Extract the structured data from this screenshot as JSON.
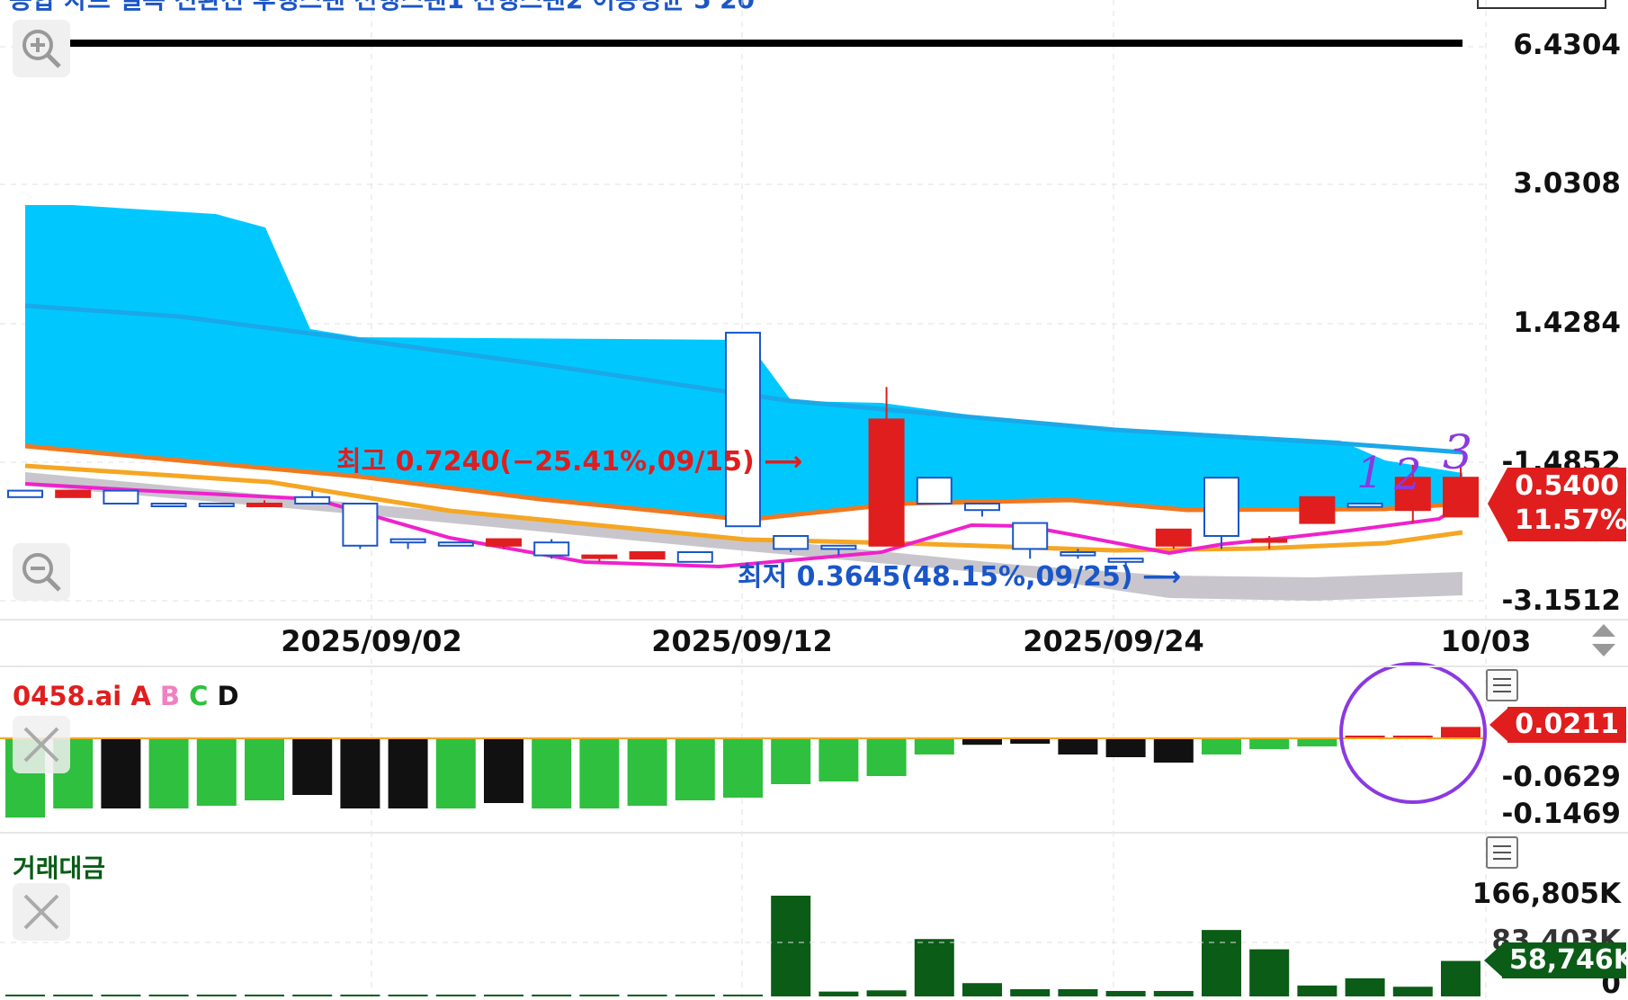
{
  "header": {
    "top_cut_text": "종합 차트 일목 전환선 후행스팬 선행스팬1 선행스팬2 이동평균 5 20"
  },
  "price_axis": {
    "labels": [
      "6.4304",
      "3.0308",
      "1.4284",
      "-1.4852",
      "-3.1512"
    ]
  },
  "current_price": {
    "value": "0.5400",
    "change": "11.57%",
    "color": "#e01e1e"
  },
  "annotations": {
    "high": "최고 0.7240(−25.41%,09/15)",
    "low": "최저 0.3645(48.15%,09/25)",
    "numbers": [
      "1",
      "2",
      "3"
    ]
  },
  "date_axis": {
    "labels": [
      "2025/09/02",
      "2025/09/12",
      "2025/09/24",
      "10/03"
    ]
  },
  "indicator": {
    "name": "0458.ai",
    "series_letters": [
      "A",
      "B",
      "C",
      "D"
    ],
    "current_value": "0.0211",
    "axis_labels": [
      "-0.0629",
      "-0.1469"
    ],
    "values": [
      -0.1469,
      -0.13,
      -0.13,
      -0.13,
      -0.125,
      -0.115,
      -0.105,
      -0.13,
      -0.13,
      -0.13,
      -0.12,
      -0.13,
      -0.13,
      -0.125,
      -0.115,
      -0.11,
      -0.085,
      -0.08,
      -0.07,
      -0.03,
      -0.012,
      -0.01,
      -0.03,
      -0.035,
      -0.045,
      -0.03,
      -0.02,
      -0.015,
      0.002,
      0.004,
      0.0211
    ],
    "bar_colors": [
      "green",
      "green",
      "black",
      "green",
      "green",
      "green",
      "black",
      "black",
      "black",
      "green",
      "black",
      "green",
      "green",
      "green",
      "green",
      "green",
      "green",
      "green",
      "green",
      "green",
      "black",
      "black",
      "black",
      "black",
      "black",
      "green",
      "green",
      "green",
      "red",
      "red",
      "red"
    ]
  },
  "volume": {
    "title": "거래대금",
    "axis_labels": [
      "166,805K",
      "83,403K",
      "0"
    ],
    "current_value": "58,746K",
    "values": [
      300,
      300,
      300,
      300,
      300,
      300,
      300,
      300,
      300,
      300,
      300,
      300,
      300,
      300,
      300,
      300,
      166805,
      8000,
      10000,
      95000,
      22000,
      12000,
      12000,
      9000,
      9000,
      110000,
      78000,
      18000,
      30000,
      16000,
      58746
    ]
  },
  "colors": {
    "cloud": "#00c8ff",
    "bull_candle": "#e01e1e",
    "bear_candle": "#1a56c8",
    "ma_short": "#ee22cc",
    "ma_long": "#f5a623",
    "baseline_orange": "#f07820",
    "lagging_gray": "#c8c6cc",
    "osc_green": "#2ec03e",
    "osc_black": "#111111",
    "volume_bar": "#0a5c16",
    "circle_annotation": "#8a3ae0"
  },
  "candles": [
    [
      0.47,
      0.48,
      0.47,
      0.48,
      "b"
    ],
    [
      0.48,
      0.47,
      0.48,
      0.47,
      "r"
    ],
    [
      0.48,
      0.46,
      0.48,
      0.46,
      "b"
    ],
    [
      0.46,
      0.46,
      0.46,
      0.46,
      "b"
    ],
    [
      0.46,
      0.46,
      0.46,
      0.46,
      "b"
    ],
    [
      0.46,
      0.46,
      0.465,
      0.455,
      "r"
    ],
    [
      0.47,
      0.46,
      0.48,
      0.46,
      "b"
    ],
    [
      0.46,
      0.395,
      0.46,
      0.39,
      "b"
    ],
    [
      0.405,
      0.4,
      0.405,
      0.39,
      "b"
    ],
    [
      0.4,
      0.395,
      0.4,
      0.395,
      "b"
    ],
    [
      0.395,
      0.405,
      0.405,
      0.39,
      "r"
    ],
    [
      0.4,
      0.38,
      0.405,
      0.375,
      "b"
    ],
    [
      0.38,
      0.38,
      0.38,
      0.37,
      "r"
    ],
    [
      0.375,
      0.385,
      0.385,
      0.375,
      "r"
    ],
    [
      0.385,
      0.37,
      0.385,
      0.37,
      "b"
    ],
    [
      0.724,
      0.425,
      0.724,
      0.425,
      "b"
    ],
    [
      0.41,
      0.39,
      0.41,
      0.385,
      "b"
    ],
    [
      0.39,
      0.395,
      0.395,
      0.38,
      "b"
    ],
    [
      0.395,
      0.59,
      0.64,
      0.395,
      "r"
    ],
    [
      0.5,
      0.46,
      0.5,
      0.46,
      "b"
    ],
    [
      0.46,
      0.45,
      0.46,
      0.44,
      "b"
    ],
    [
      0.43,
      0.39,
      0.43,
      0.375,
      "b"
    ],
    [
      0.385,
      0.38,
      0.39,
      0.375,
      "b"
    ],
    [
      0.375,
      0.37,
      0.375,
      0.3645,
      "b"
    ],
    [
      0.395,
      0.42,
      0.42,
      0.39,
      "r"
    ],
    [
      0.5,
      0.41,
      0.5,
      0.39,
      "b"
    ],
    [
      0.405,
      0.405,
      0.41,
      0.39,
      "r"
    ],
    [
      0.43,
      0.47,
      0.47,
      0.43,
      "r"
    ],
    [
      0.46,
      0.455,
      0.46,
      0.455,
      "b"
    ],
    [
      0.45,
      0.5,
      0.52,
      0.43,
      "r"
    ],
    [
      0.44,
      0.5,
      0.52,
      0.44,
      "r"
    ]
  ]
}
